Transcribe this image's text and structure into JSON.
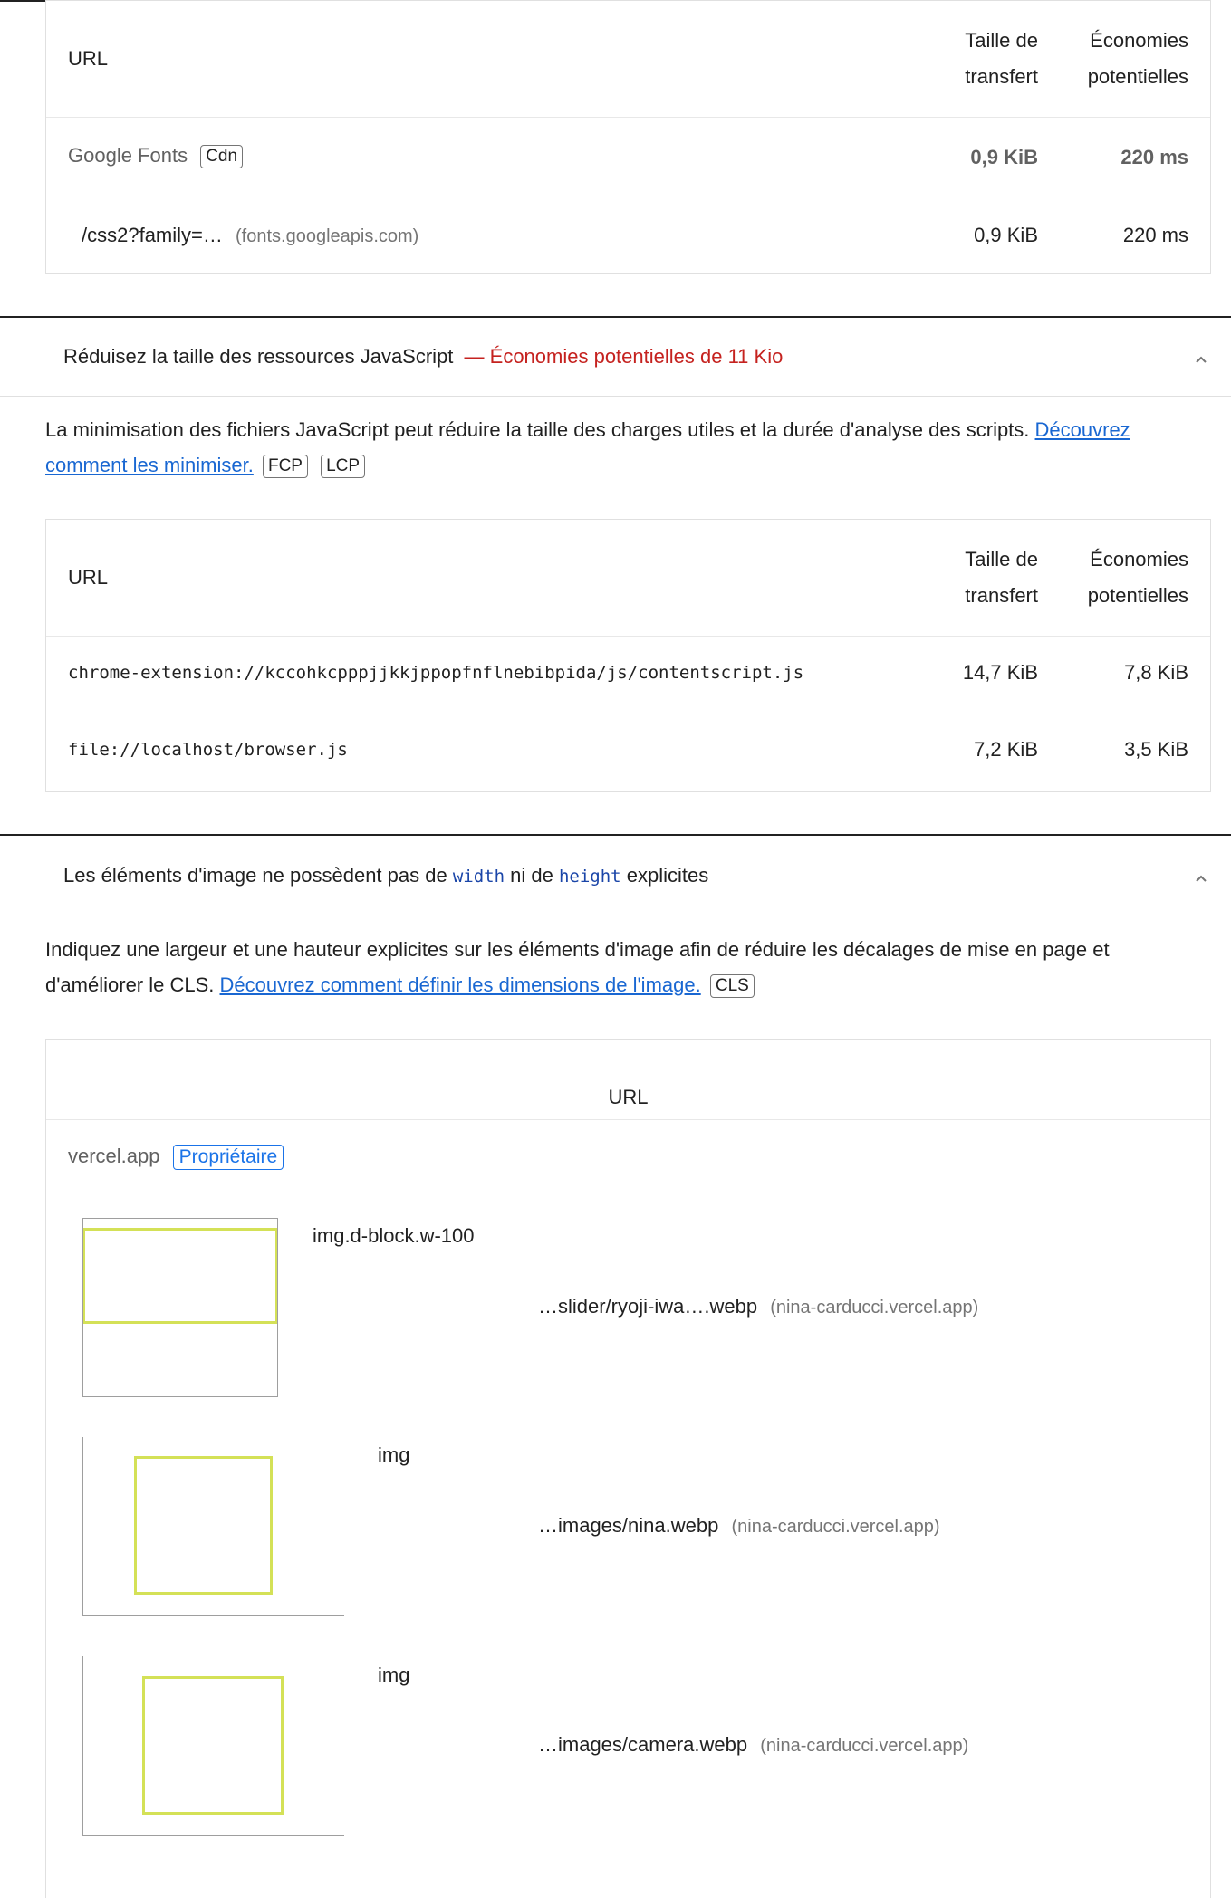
{
  "table1": {
    "col_url": "URL",
    "col_size": [
      "Taille de",
      "transfert"
    ],
    "col_savings": [
      "Économies",
      "potentielles"
    ],
    "group": {
      "name": "Google Fonts",
      "tag": "Cdn",
      "size": "0,9 KiB",
      "savings": "220 ms"
    },
    "rows": [
      {
        "url": "/css2?family=…",
        "host": "(fonts.googleapis.com)",
        "size": "0,9 KiB",
        "savings": "220 ms"
      }
    ]
  },
  "audit_js": {
    "title": "Réduisez la taille des ressources JavaScript",
    "savings_text": " — Économies potentielles de 11 Kio",
    "desc_text": "La minimisation des fichiers JavaScript peut réduire la taille des charges utiles et la durée d'analyse des scripts. ",
    "desc_link_1": "Découvrez",
    "desc_link_2": "comment les minimiser.",
    "tags": [
      "FCP",
      "LCP"
    ],
    "table": {
      "col_url": "URL",
      "col_size": [
        "Taille de",
        "transfert"
      ],
      "col_savings": [
        "Économies",
        "potentielles"
      ],
      "rows": [
        {
          "url": "chrome-extension://kccohkcpppjjkkjppopfnflnebibpida/js/contentscript.js",
          "size": "14,7 KiB",
          "savings": "7,8 KiB"
        },
        {
          "url": "file://localhost/browser.js",
          "size": "7,2 KiB",
          "savings": "3,5 KiB"
        }
      ]
    }
  },
  "audit_img": {
    "title_pre": "Les éléments d'image ne possèdent pas de ",
    "code1": "width",
    "title_mid": " ni de ",
    "code2": "height",
    "title_post": " explicites",
    "desc_line1": "Indiquez une largeur et une hauteur explicites sur les éléments d'image afin de réduire les décalages de mise en page et",
    "desc_line2": "d'améliorer le CLS. ",
    "desc_link": "Découvrez comment définir les dimensions de l'image.",
    "tag": "CLS",
    "table": {
      "col_url": "URL",
      "group": {
        "name": "vercel.app",
        "tag": "Propriétaire"
      },
      "rows": [
        {
          "selector": "img.d-block.w-100",
          "url": "…slider/ryoji-iwa….webp",
          "host": "(nina-carducci.vercel.app)"
        },
        {
          "selector": "img",
          "url": "…images/nina.webp",
          "host": "(nina-carducci.vercel.app)"
        },
        {
          "selector": "img",
          "url": "…images/camera.webp",
          "host": "(nina-carducci.vercel.app)"
        }
      ]
    }
  },
  "colors": {
    "savings_red": "#c5221f",
    "link_blue": "#1967d2",
    "owner_blue": "#1a73e8",
    "thumb_yellow": "#d4e157"
  }
}
